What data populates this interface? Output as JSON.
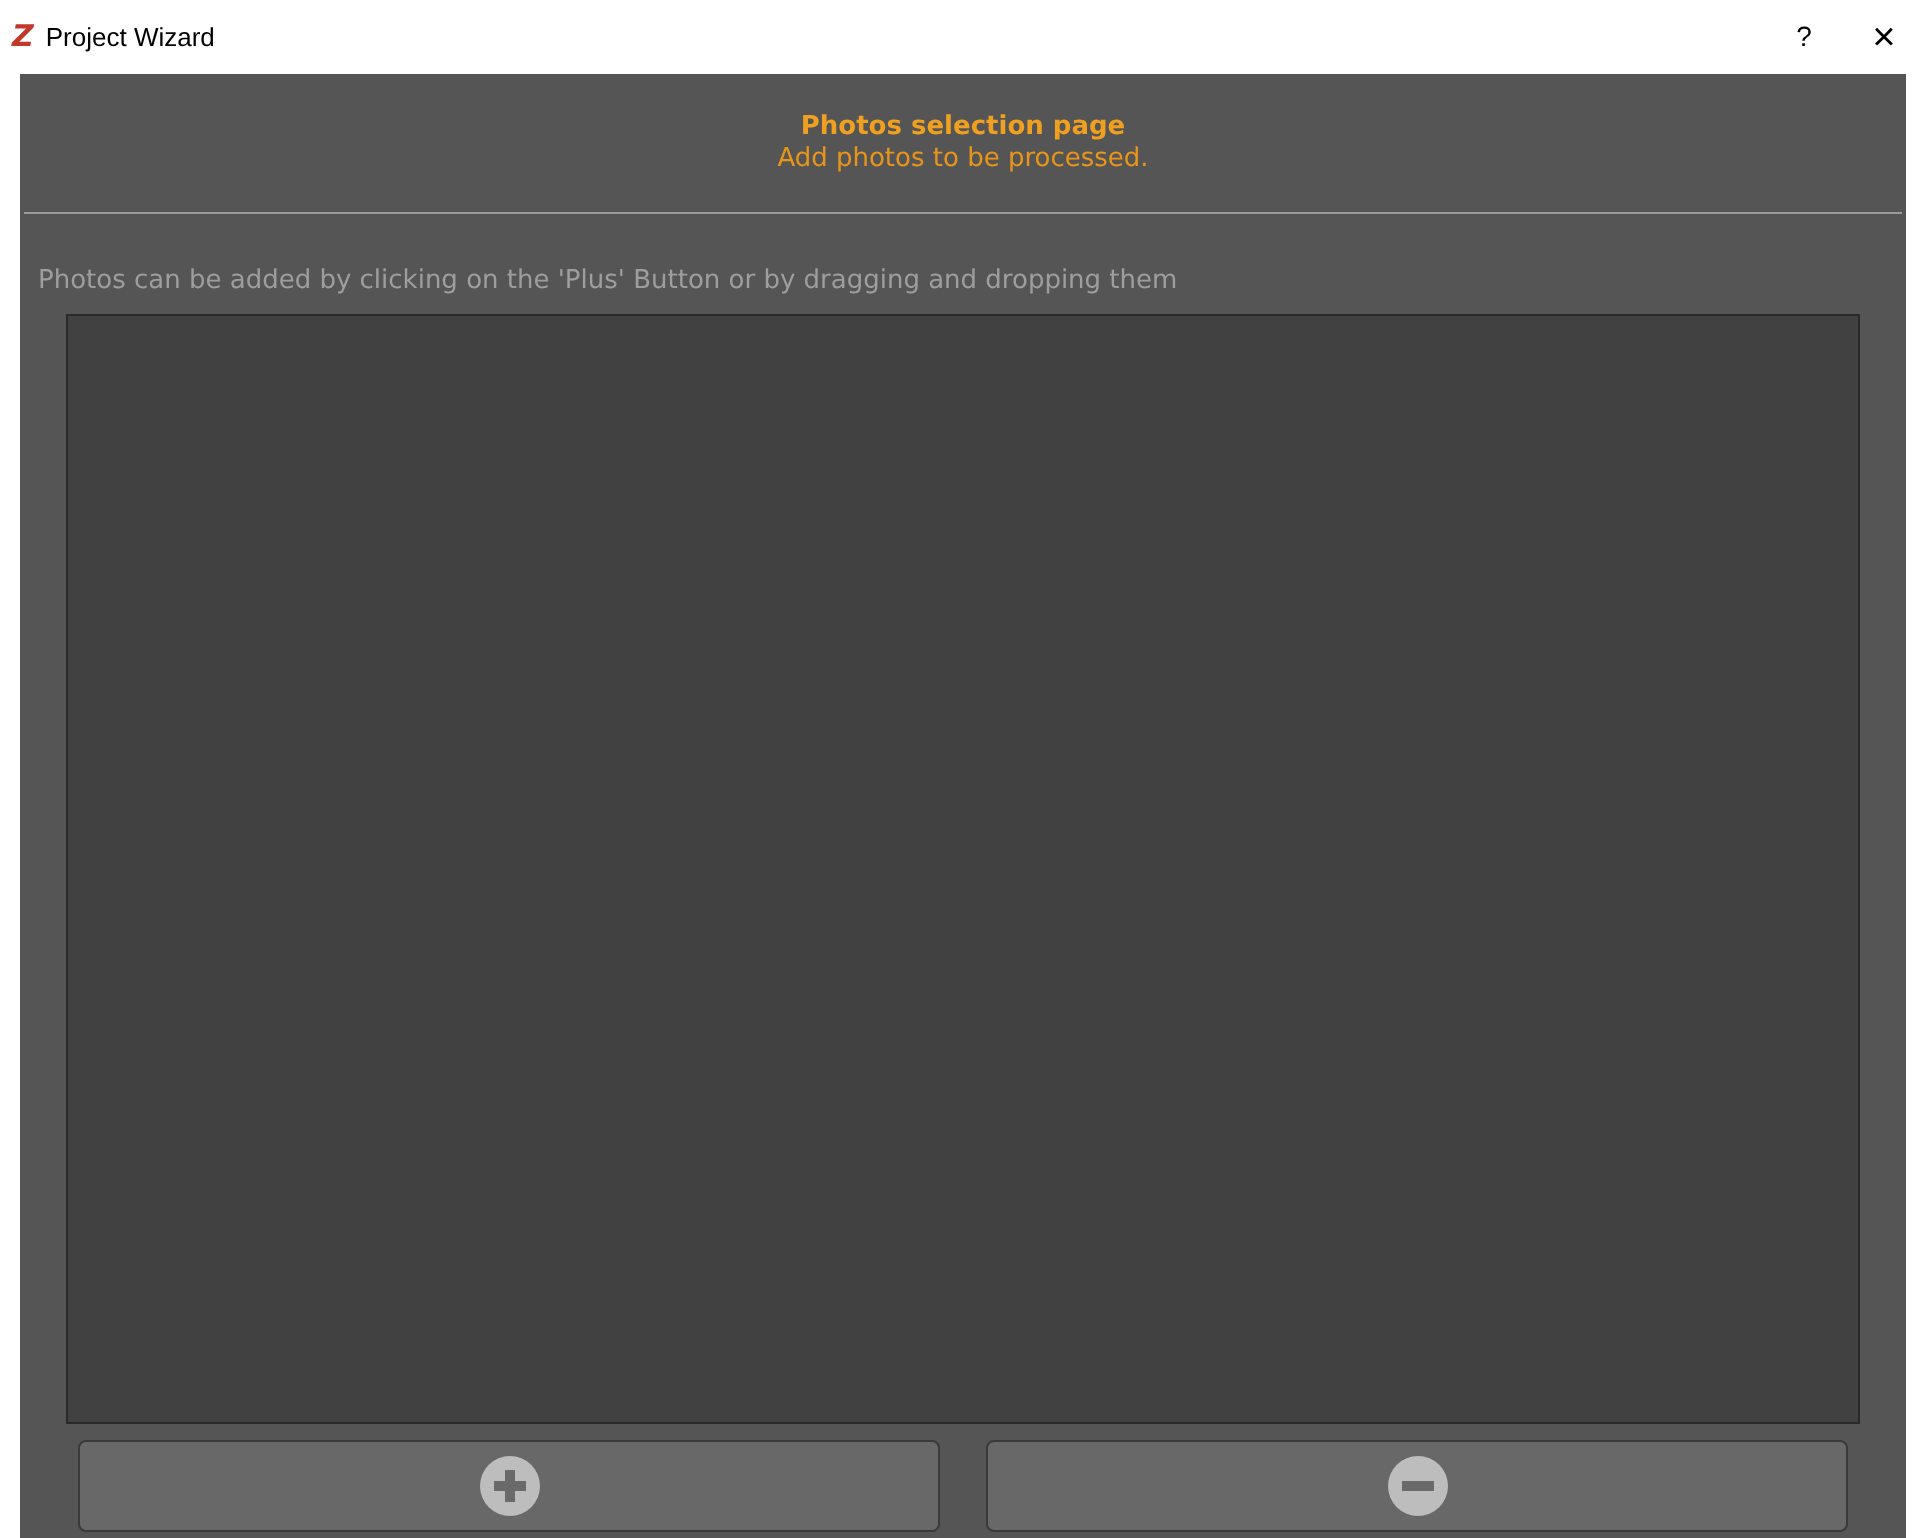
{
  "window": {
    "logo": "Z",
    "title": "Project Wizard",
    "help": "?",
    "close": "×"
  },
  "header": {
    "title": "Photos selection page",
    "subtitle": "Add photos to be processed."
  },
  "instructions": "Photos can be added by clicking on the 'Plus' Button or by dragging and dropping them",
  "buttons": [
    {
      "kind": "add"
    },
    {
      "kind": "remove"
    }
  ]
}
